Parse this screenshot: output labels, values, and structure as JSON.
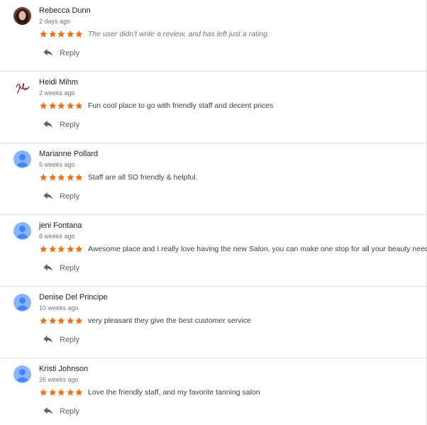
{
  "colors": {
    "star": "#e8711a",
    "avatar_default": "#8ab4f8",
    "avatar_person": "#4285f4"
  },
  "reviews": [
    {
      "name": "Rebecca Dunn",
      "time": "2 days ago",
      "rating": 5,
      "text": "The user didn't write a review, and has left just a rating.",
      "reply_label": "Reply",
      "avatar": "photo-avatar"
    },
    {
      "name": "Heidi Mihm",
      "time": "2 weeks ago",
      "rating": 5,
      "text": "Fun cool place to go with friendly staff and decent prices",
      "reply_label": "Reply",
      "avatar": "signature-avatar"
    },
    {
      "name": "Marianne Pollard",
      "time": "5 weeks ago",
      "rating": 5,
      "text": "Staff are all SO friendly & helpful.",
      "reply_label": "Reply",
      "avatar": "default-avatar"
    },
    {
      "name": "jeni Fontana",
      "time": "8 weeks ago",
      "rating": 5,
      "text": "Awesome place and I really love having the new Salon, you can make one stop for all your beauty needs!",
      "reply_label": "Reply",
      "avatar": "default-avatar"
    },
    {
      "name": "Denise Del Principe",
      "time": "10 weeks ago",
      "rating": 5,
      "text": "very pleasant they give the best customer service",
      "reply_label": "Reply",
      "avatar": "default-avatar"
    },
    {
      "name": "Kristi Johnson",
      "time": "26 weeks ago",
      "rating": 5,
      "text": "Love the friendly staff, and my favorite tanning salon",
      "reply_label": "Reply",
      "avatar": "default-avatar"
    }
  ]
}
